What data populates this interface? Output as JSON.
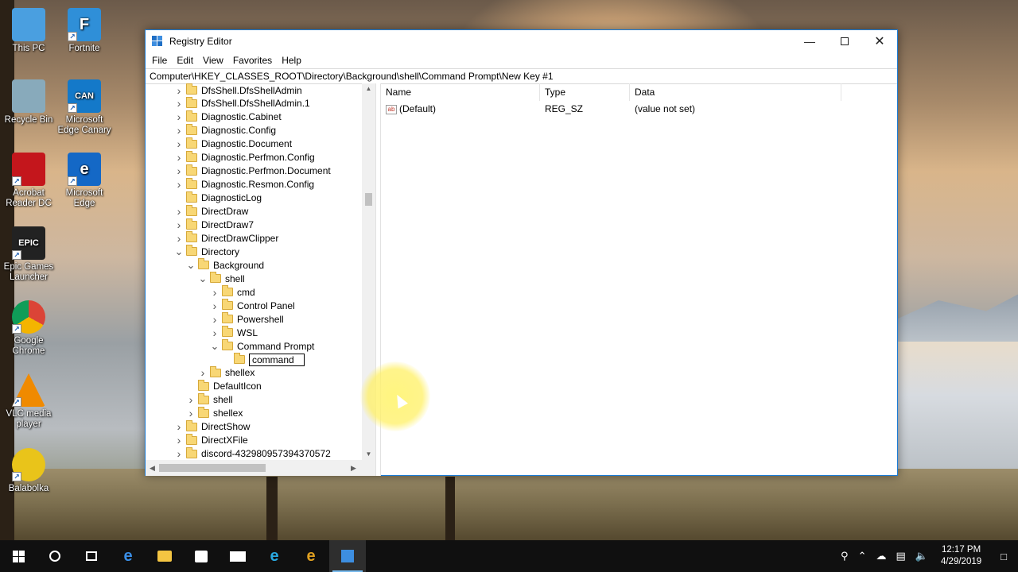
{
  "desktop": {
    "icons": [
      {
        "label": "This PC",
        "icon": "this-pc-icon"
      },
      {
        "label": "Fortnite",
        "icon": "fortnite-icon",
        "glyph": "F"
      },
      {
        "label": "Recycle Bin",
        "icon": "recycle-bin-icon"
      },
      {
        "label": "Microsoft Edge Canary",
        "icon": "edge-canary-icon",
        "glyph": "CAN"
      },
      {
        "label": "Acrobat Reader DC",
        "icon": "acrobat-icon"
      },
      {
        "label": "Microsoft Edge",
        "icon": "edge-icon",
        "glyph": "e"
      },
      {
        "label": "Epic Games Launcher",
        "icon": "epic-games-icon",
        "glyph": "EPIC"
      },
      {
        "label": "Google Chrome",
        "icon": "chrome-icon"
      },
      {
        "label": "VLC media player",
        "icon": "vlc-icon"
      },
      {
        "label": "Balabolka",
        "icon": "balabolka-icon"
      }
    ]
  },
  "window": {
    "title": "Registry Editor",
    "menu": [
      "File",
      "Edit",
      "View",
      "Favorites",
      "Help"
    ],
    "address": "Computer\\HKEY_CLASSES_ROOT\\Directory\\Background\\shell\\Command Prompt\\New Key #1",
    "tree": [
      {
        "label": "DfsShell.DfsShellAdmin",
        "level": 0,
        "state": "collapsed"
      },
      {
        "label": "DfsShell.DfsShellAdmin.1",
        "level": 0,
        "state": "collapsed"
      },
      {
        "label": "Diagnostic.Cabinet",
        "level": 0,
        "state": "collapsed"
      },
      {
        "label": "Diagnostic.Config",
        "level": 0,
        "state": "collapsed"
      },
      {
        "label": "Diagnostic.Document",
        "level": 0,
        "state": "collapsed"
      },
      {
        "label": "Diagnostic.Perfmon.Config",
        "level": 0,
        "state": "collapsed"
      },
      {
        "label": "Diagnostic.Perfmon.Document",
        "level": 0,
        "state": "collapsed"
      },
      {
        "label": "Diagnostic.Resmon.Config",
        "level": 0,
        "state": "collapsed"
      },
      {
        "label": "DiagnosticLog",
        "level": 0,
        "state": "leaf"
      },
      {
        "label": "DirectDraw",
        "level": 0,
        "state": "collapsed"
      },
      {
        "label": "DirectDraw7",
        "level": 0,
        "state": "collapsed"
      },
      {
        "label": "DirectDrawClipper",
        "level": 0,
        "state": "collapsed"
      },
      {
        "label": "Directory",
        "level": 0,
        "state": "expanded"
      },
      {
        "label": "Background",
        "level": 1,
        "state": "expanded"
      },
      {
        "label": "shell",
        "level": 2,
        "state": "expanded"
      },
      {
        "label": "cmd",
        "level": 3,
        "state": "collapsed"
      },
      {
        "label": "Control Panel",
        "level": 3,
        "state": "collapsed"
      },
      {
        "label": "Powershell",
        "level": 3,
        "state": "collapsed"
      },
      {
        "label": "WSL",
        "level": 3,
        "state": "collapsed"
      },
      {
        "label": "Command Prompt",
        "level": 3,
        "state": "expanded"
      },
      {
        "label": "command",
        "level": 4,
        "state": "editing"
      },
      {
        "label": "shellex",
        "level": 2,
        "state": "collapsed"
      },
      {
        "label": "DefaultIcon",
        "level": 1,
        "state": "leaf"
      },
      {
        "label": "shell",
        "level": 1,
        "state": "collapsed"
      },
      {
        "label": "shellex",
        "level": 1,
        "state": "collapsed"
      },
      {
        "label": "DirectShow",
        "level": 0,
        "state": "collapsed"
      },
      {
        "label": "DirectXFile",
        "level": 0,
        "state": "collapsed"
      },
      {
        "label": "discord-432980957394370572",
        "level": 0,
        "state": "collapsed"
      }
    ],
    "list": {
      "columns": [
        "Name",
        "Type",
        "Data"
      ],
      "rows": [
        {
          "name": "(Default)",
          "type": "REG_SZ",
          "data": "(value not set)",
          "icon_text": "ab"
        }
      ]
    }
  },
  "taskbar": {
    "items": [
      "start-icon",
      "search-circle-icon",
      "task-view-icon",
      "edge-taskbar-icon",
      "file-explorer-icon",
      "store-icon",
      "mail-icon",
      "ie-icon",
      "edge-canary-taskbar-icon",
      "regedit-taskbar-icon"
    ],
    "active": "regedit-taskbar-icon",
    "time": "12:17 PM",
    "date": "4/29/2019"
  },
  "colors": {
    "accent": "#1a7ad4",
    "folder": "#f8d775",
    "taskbar": "#101010",
    "highlight": "#fff176"
  }
}
